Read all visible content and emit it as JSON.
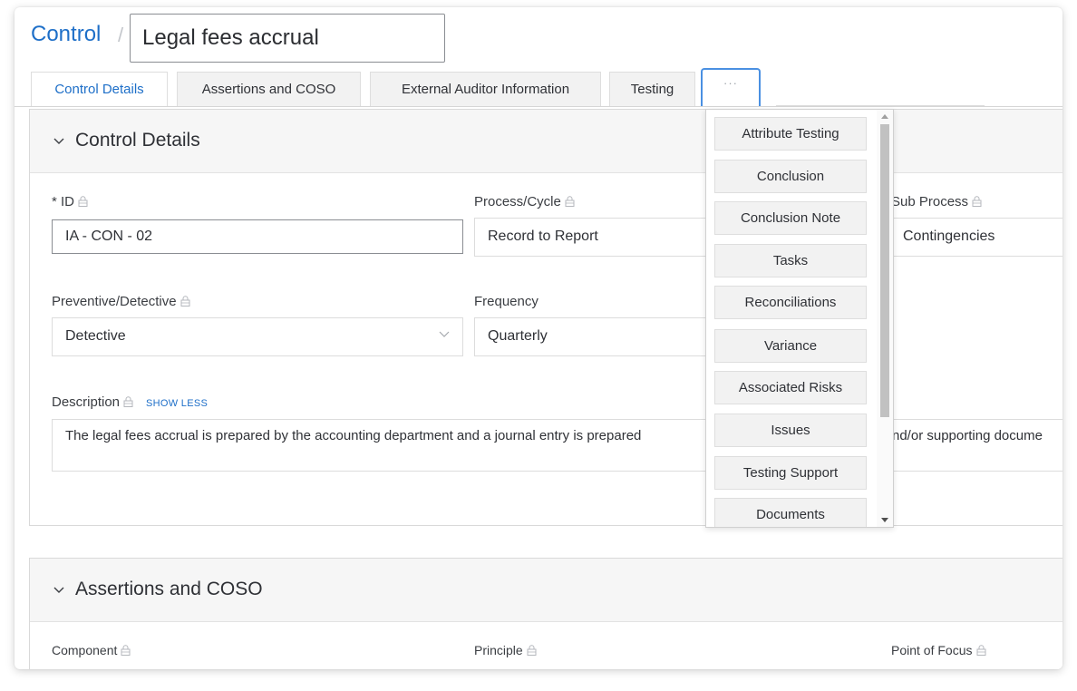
{
  "header": {
    "breadcrumb_root": "Control",
    "breadcrumb_separator": "/",
    "title_value": "Legal fees accrual"
  },
  "tabs": [
    {
      "label": "Control Details",
      "active": true
    },
    {
      "label": "Assertions and COSO",
      "active": false
    },
    {
      "label": "External Auditor Information",
      "active": false
    },
    {
      "label": "Testing",
      "active": false
    },
    {
      "label": "···",
      "active": false
    }
  ],
  "more_menu": {
    "items": [
      "Attribute Testing",
      "Conclusion",
      "Conclusion Note",
      "Tasks",
      "Reconciliations",
      "Variance",
      "Associated Risks",
      "Issues",
      "Testing Support",
      "Documents"
    ]
  },
  "control_details": {
    "section_title": "Control Details",
    "id_label": "* ID",
    "id_value": "IA - CON - 02",
    "process_label": "Process/Cycle",
    "process_value": "Record to Report",
    "subprocess_label": "Sub Process",
    "subprocess_value": "Contingencies",
    "prev_det_label": "Preventive/Detective",
    "prev_det_value": "Detective",
    "frequency_label": "Frequency",
    "frequency_value": "Quarterly",
    "description_label": "Description",
    "show_less": "SHOW LESS",
    "description_value": "The legal fees accrual is prepared by the accounting department and a journal entry is prepared",
    "description_right_fragment": "nd/or supporting docume"
  },
  "assertions_coso": {
    "section_title": "Assertions and COSO",
    "component_label": "Component",
    "principle_label": "Principle",
    "point_of_focus_label": "Point of Focus"
  },
  "colors": {
    "accent": "#1e6fc8",
    "focus_border": "#4a90e2"
  },
  "icons": [
    "lock-icon",
    "chevron-down-icon",
    "collapse-chevron-icon"
  ]
}
